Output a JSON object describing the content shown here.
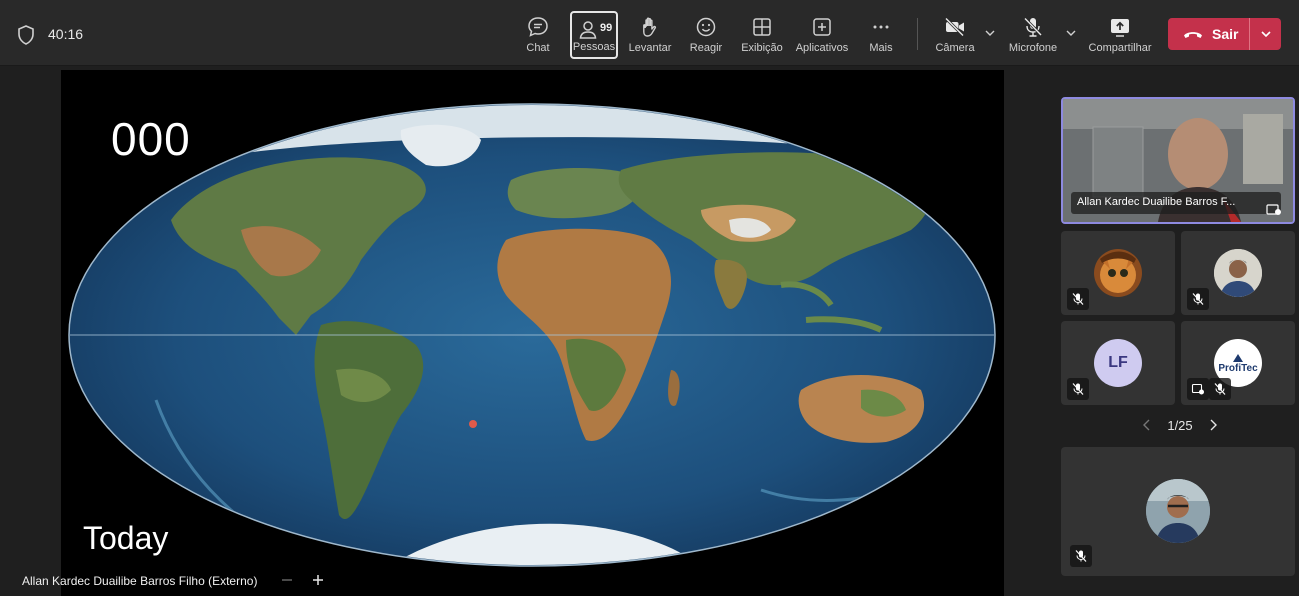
{
  "meeting": {
    "timer": "40:16"
  },
  "toolbar": {
    "chat_label": "Chat",
    "people_label": "Pessoas",
    "people_count": "99",
    "raise_label": "Levantar",
    "react_label": "Reagir",
    "view_label": "Exibição",
    "apps_label": "Aplicativos",
    "more_label": "Mais",
    "camera_label": "Câmera",
    "mic_label": "Microfone",
    "share_label": "Compartilhar",
    "leave_label": "Sair"
  },
  "presentation": {
    "counter": "000",
    "caption": "Today",
    "presenter": "Allan Kardec Duailibe Barros Filho (Externo)"
  },
  "participants": {
    "featured_name": "Allan Kardec Duailibe Barros F...",
    "lf_initials": "LF",
    "profitec_label": "ProfiTec",
    "pager": "1/25"
  },
  "colors": {
    "leave": "#c4314b",
    "active_tile_border": "#8e8ae0",
    "lf_avatar": "#cfcbf0"
  }
}
